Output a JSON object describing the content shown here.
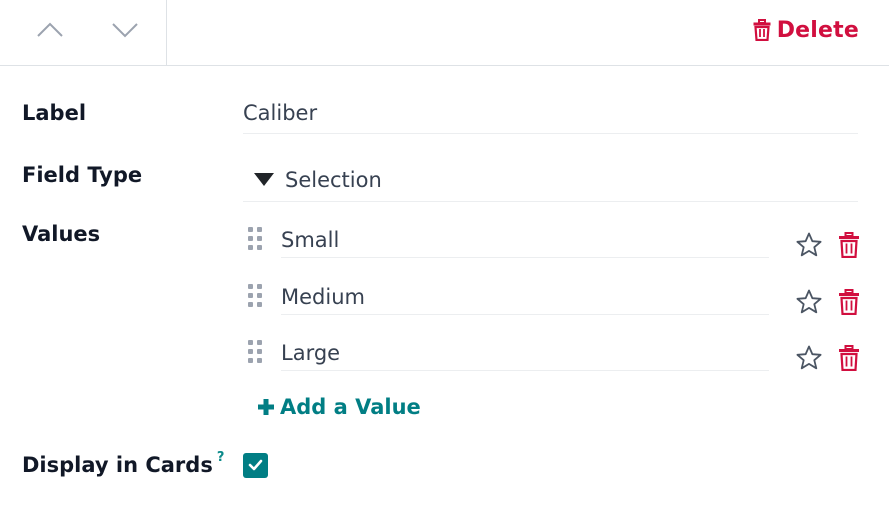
{
  "toolbar": {
    "prev_icon": "chevron-up-icon",
    "next_icon": "chevron-down-icon",
    "delete_label": "Delete",
    "delete_icon": "trash-icon",
    "delete_color": "#d10f3f"
  },
  "form": {
    "label_field": {
      "label": "Label",
      "value": "Caliber"
    },
    "type_field": {
      "label": "Field Type",
      "value": "Selection",
      "icon": "caret-down-icon"
    },
    "values_field": {
      "label": "Values",
      "items": [
        {
          "value": "Small"
        },
        {
          "value": "Medium"
        },
        {
          "value": "Large"
        }
      ],
      "add_label": "Add a Value",
      "add_icon": "plus-icon",
      "row_icons": [
        "drag-handle-icon",
        "star-icon",
        "trash-icon"
      ]
    },
    "display_field": {
      "label": "Display in Cards",
      "help": "?",
      "checked": true
    }
  },
  "colors": {
    "accent": "#017e84",
    "danger": "#d10f3f",
    "text": "#111827"
  }
}
